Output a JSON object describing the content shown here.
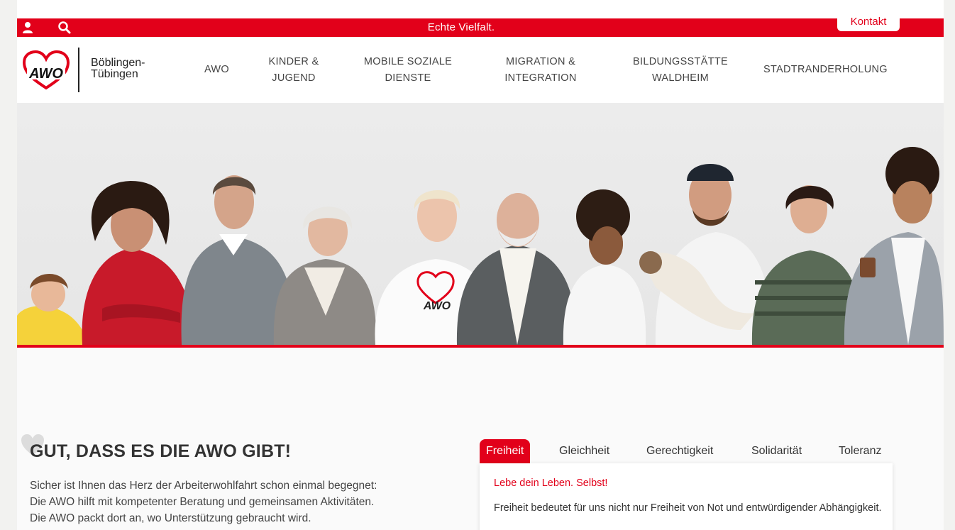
{
  "topbar": {
    "tagline": "Echte Vielfalt.",
    "contact_label": "Kontakt"
  },
  "brand": {
    "logo_text": "AWO",
    "line1": "Böblingen-",
    "line2": "Tübingen"
  },
  "nav": [
    {
      "line1": "AWO",
      "line2": ""
    },
    {
      "line1": "KINDER &",
      "line2": "JUGEND"
    },
    {
      "line1": "MOBILE SOZIALE",
      "line2": "DIENSTE"
    },
    {
      "line1": "MIGRATION &",
      "line2": "INTEGRATION"
    },
    {
      "line1": "BILDUNGSSTÄTTE",
      "line2": "WALDHEIM"
    },
    {
      "line1": "STADTRANDERHOLUNG",
      "line2": ""
    }
  ],
  "hero": {
    "shirt_logo": "AWO"
  },
  "content": {
    "headline": "GUT, DASS ES DIE AWO GIBT!",
    "intro_lines": [
      "Sicher ist Ihnen das Herz der Arbeiterwohlfahrt schon einmal begegnet:",
      "Die AWO hilft mit kompetenter Beratung und gemeinsamen Aktivitäten.",
      "Die AWO packt dort an, wo Unterstützung gebraucht wird."
    ]
  },
  "tabs": [
    {
      "label": "Freiheit"
    },
    {
      "label": "Gleichheit"
    },
    {
      "label": "Gerechtigkeit"
    },
    {
      "label": "Solidarität"
    },
    {
      "label": "Toleranz"
    }
  ],
  "panel": {
    "title": "Lebe dein Leben. Selbst!",
    "text": "Freiheit bedeutet für uns nicht nur Freiheit von Not und entwürdigender Abhängigkeit."
  },
  "colors": {
    "brand_red": "#e2001a",
    "text_dark": "#333333"
  }
}
